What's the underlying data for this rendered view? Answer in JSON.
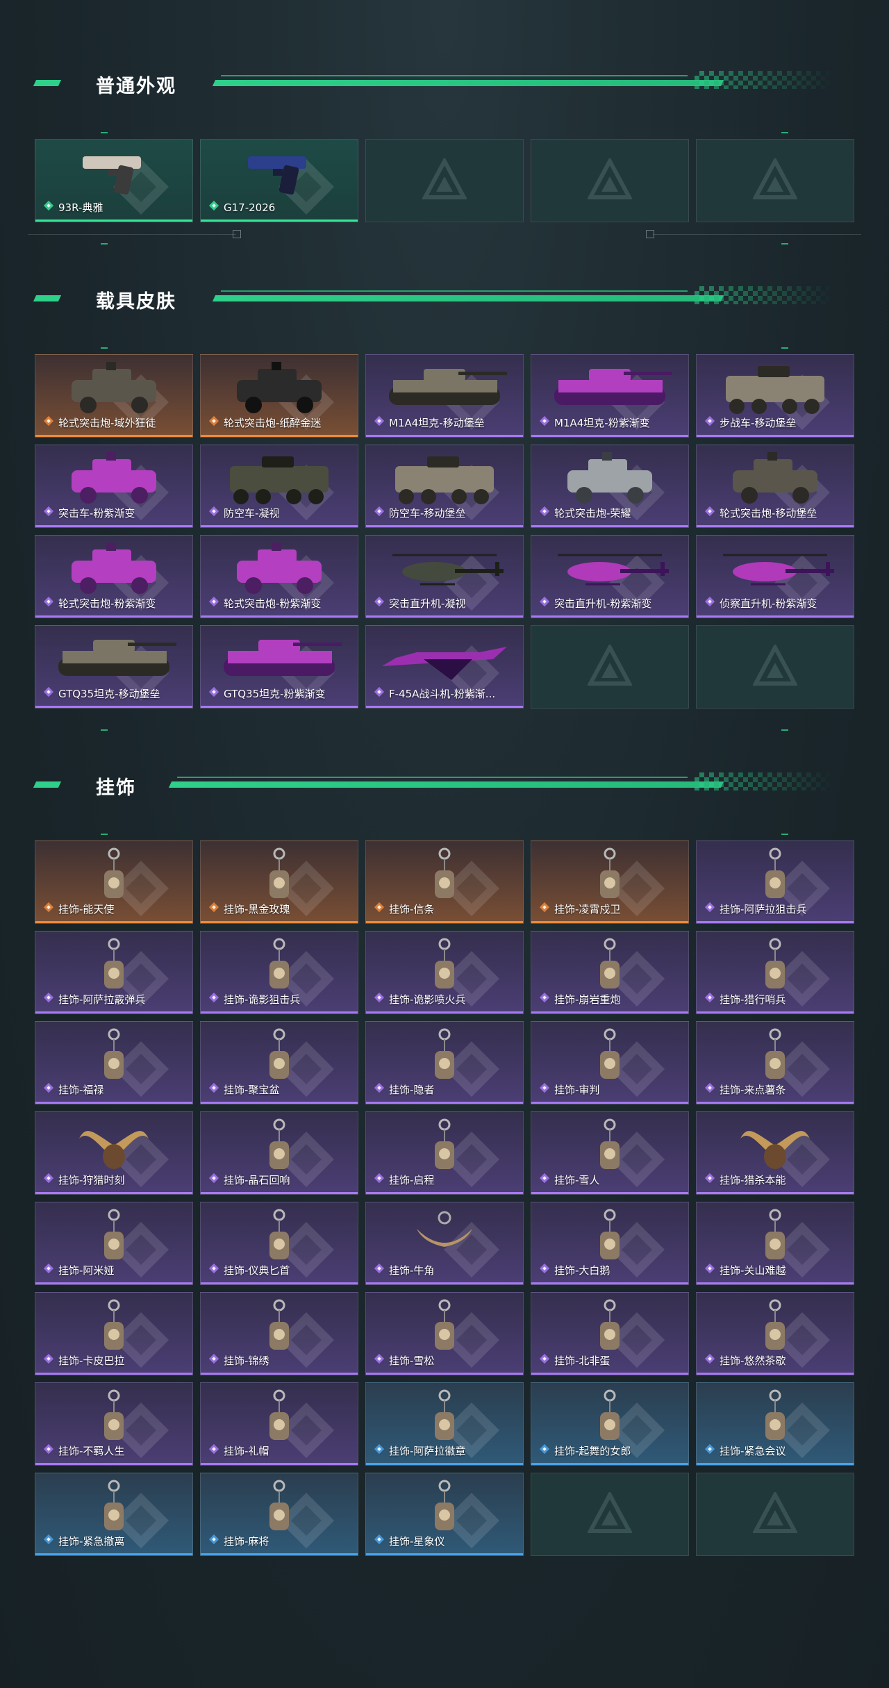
{
  "sections": [
    {
      "title": "普通外观",
      "items": [
        {
          "label": "93R-典雅",
          "rarity": "green",
          "art": "pistol-silver"
        },
        {
          "label": "G17-2026",
          "rarity": "green",
          "art": "pistol-blue"
        },
        {
          "label": "",
          "rarity": "empty"
        },
        {
          "label": "",
          "rarity": "empty"
        },
        {
          "label": "",
          "rarity": "empty"
        }
      ]
    },
    {
      "title": "载具皮肤",
      "items": [
        {
          "label": "轮式突击炮-域外狂徒",
          "rarity": "orange",
          "art": "vehicle-camo"
        },
        {
          "label": "轮式突击炮-纸醉金迷",
          "rarity": "orange",
          "art": "vehicle-black"
        },
        {
          "label": "M1A4坦克-移动堡垒",
          "rarity": "purple",
          "art": "tank-camo"
        },
        {
          "label": "M1A4坦克-粉紫渐变",
          "rarity": "purple",
          "art": "tank-pink"
        },
        {
          "label": "步战车-移动堡垒",
          "rarity": "purple",
          "art": "apc-camo"
        },
        {
          "label": "突击车-粉紫渐变",
          "rarity": "purple",
          "art": "vehicle-pink"
        },
        {
          "label": "防空车-凝视",
          "rarity": "purple",
          "art": "apc-dark"
        },
        {
          "label": "防空车-移动堡垒",
          "rarity": "purple",
          "art": "apc-camo"
        },
        {
          "label": "轮式突击炮-荣耀",
          "rarity": "purple",
          "art": "vehicle-grey"
        },
        {
          "label": "轮式突击炮-移动堡垒",
          "rarity": "purple",
          "art": "vehicle-camo"
        },
        {
          "label": "轮式突击炮-粉紫渐变",
          "rarity": "purple",
          "art": "vehicle-pink"
        },
        {
          "label": "轮式突击炮-粉紫渐变",
          "rarity": "purple",
          "art": "vehicle-pink"
        },
        {
          "label": "突击直升机-凝视",
          "rarity": "purple",
          "art": "heli-dark"
        },
        {
          "label": "突击直升机-粉紫渐变",
          "rarity": "purple",
          "art": "heli-pink"
        },
        {
          "label": "侦察直升机-粉紫渐变",
          "rarity": "purple",
          "art": "heli-pink"
        },
        {
          "label": "GTQ35坦克-移动堡垒",
          "rarity": "purple",
          "art": "tank-camo"
        },
        {
          "label": "GTQ35坦克-粉紫渐变",
          "rarity": "purple",
          "art": "tank-pink"
        },
        {
          "label": "F-45A战斗机-粉紫渐...",
          "rarity": "purple",
          "art": "jet-pink"
        },
        {
          "label": "",
          "rarity": "empty"
        },
        {
          "label": "",
          "rarity": "empty"
        }
      ]
    },
    {
      "title": "挂饰",
      "items": [
        {
          "label": "挂饰-能天使",
          "rarity": "orange",
          "art": "charm"
        },
        {
          "label": "挂饰-黑金玫瑰",
          "rarity": "orange",
          "art": "charm"
        },
        {
          "label": "挂饰-信条",
          "rarity": "orange",
          "art": "charm"
        },
        {
          "label": "挂饰-凌霄戍卫",
          "rarity": "orange",
          "art": "charm"
        },
        {
          "label": "挂饰-阿萨拉狙击兵",
          "rarity": "purple",
          "art": "charm"
        },
        {
          "label": "挂饰-阿萨拉霰弹兵",
          "rarity": "purple",
          "art": "charm"
        },
        {
          "label": "挂饰-诡影狙击兵",
          "rarity": "purple",
          "art": "charm"
        },
        {
          "label": "挂饰-诡影喷火兵",
          "rarity": "purple",
          "art": "charm"
        },
        {
          "label": "挂饰-崩岩重炮",
          "rarity": "purple",
          "art": "charm"
        },
        {
          "label": "挂饰-猎行哨兵",
          "rarity": "purple",
          "art": "charm"
        },
        {
          "label": "挂饰-福禄",
          "rarity": "purple",
          "art": "charm"
        },
        {
          "label": "挂饰-聚宝盆",
          "rarity": "purple",
          "art": "charm"
        },
        {
          "label": "挂饰-隐者",
          "rarity": "purple",
          "art": "charm"
        },
        {
          "label": "挂饰-审判",
          "rarity": "purple",
          "art": "charm"
        },
        {
          "label": "挂饰-来点薯条",
          "rarity": "purple",
          "art": "charm"
        },
        {
          "label": "挂饰-狩猎时刻",
          "rarity": "purple",
          "art": "antlers"
        },
        {
          "label": "挂饰-晶石回响",
          "rarity": "purple",
          "art": "charm"
        },
        {
          "label": "挂饰-启程",
          "rarity": "purple",
          "art": "charm"
        },
        {
          "label": "挂饰-雪人",
          "rarity": "purple",
          "art": "charm"
        },
        {
          "label": "挂饰-猎杀本能",
          "rarity": "purple",
          "art": "antlers"
        },
        {
          "label": "挂饰-阿米娅",
          "rarity": "purple",
          "art": "charm"
        },
        {
          "label": "挂饰-仪典匕首",
          "rarity": "purple",
          "art": "charm"
        },
        {
          "label": "挂饰-牛角",
          "rarity": "purple",
          "art": "horns"
        },
        {
          "label": "挂饰-大白鹅",
          "rarity": "purple",
          "art": "charm"
        },
        {
          "label": "挂饰-关山难越",
          "rarity": "purple",
          "art": "charm"
        },
        {
          "label": "挂饰-卡皮巴拉",
          "rarity": "purple",
          "art": "charm"
        },
        {
          "label": "挂饰-锦绣",
          "rarity": "purple",
          "art": "charm"
        },
        {
          "label": "挂饰-雪松",
          "rarity": "purple",
          "art": "charm"
        },
        {
          "label": "挂饰-北非蛋",
          "rarity": "purple",
          "art": "charm"
        },
        {
          "label": "挂饰-悠然茶歇",
          "rarity": "purple",
          "art": "charm"
        },
        {
          "label": "挂饰-不羁人生",
          "rarity": "purple",
          "art": "charm"
        },
        {
          "label": "挂饰-礼帽",
          "rarity": "purple",
          "art": "charm"
        },
        {
          "label": "挂饰-阿萨拉徽章",
          "rarity": "blue",
          "art": "charm"
        },
        {
          "label": "挂饰-起舞的女郎",
          "rarity": "blue",
          "art": "charm"
        },
        {
          "label": "挂饰-紧急会议",
          "rarity": "blue",
          "art": "charm"
        },
        {
          "label": "挂饰-紧急撤离",
          "rarity": "blue",
          "art": "charm"
        },
        {
          "label": "挂饰-麻将",
          "rarity": "blue",
          "art": "charm"
        },
        {
          "label": "挂饰-星象仪",
          "rarity": "blue",
          "art": "charm"
        },
        {
          "label": "",
          "rarity": "empty"
        },
        {
          "label": "",
          "rarity": "empty"
        }
      ]
    }
  ],
  "colors": {
    "accent": "#2ed08a",
    "green": "#36e59a",
    "orange": "#ef8a3a",
    "purple": "#a779f2",
    "blue": "#4ba2e8"
  }
}
